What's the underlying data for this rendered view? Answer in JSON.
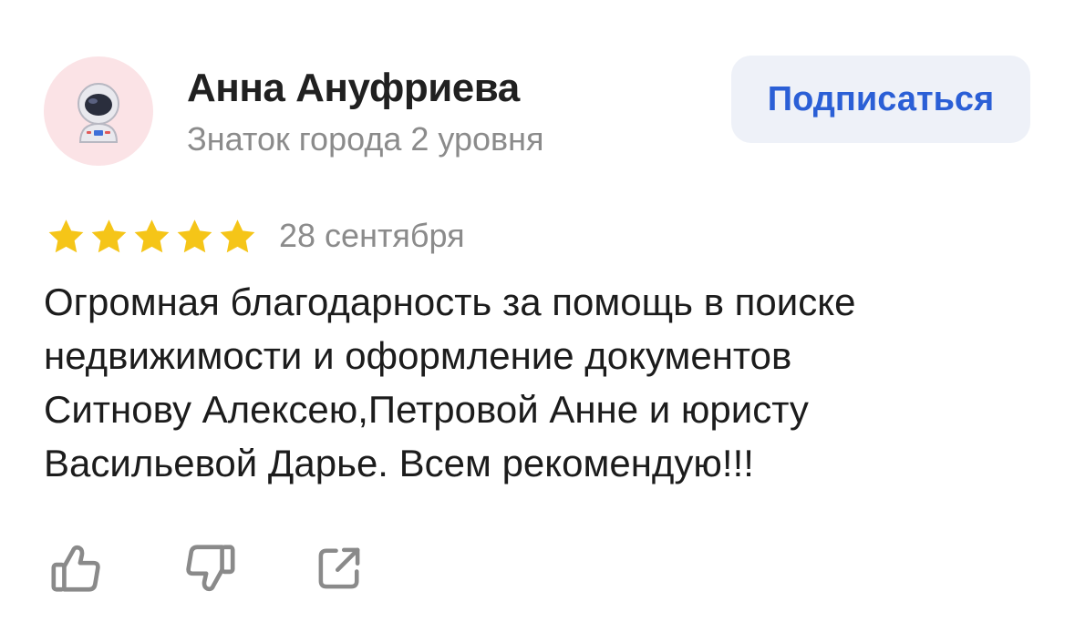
{
  "author": {
    "name": "Анна Ануфриева",
    "level": "Знаток города 2 уровня",
    "avatar_icon": "astronaut-icon"
  },
  "subscribe": {
    "label": "Подписаться"
  },
  "review": {
    "rating": 5,
    "rating_max": 5,
    "date": "28 сентября",
    "text": "Огромная благодарность за помощь в поиске\nнедвижимости и оформление документов\nСитнову Алексею,Петровой Анне и юристу\nВасильевой Дарье. Всем рекомендую!!!"
  },
  "actions": {
    "like_icon": "thumbs-up-icon",
    "dislike_icon": "thumbs-down-icon",
    "share_icon": "share-icon"
  },
  "colors": {
    "star": "#f5c518",
    "accent": "#2b5fd6",
    "avatar_bg": "#fbe3e6",
    "button_bg": "#eef1f8",
    "muted_text": "#8b8b8b",
    "icon": "#8a8a8a"
  }
}
